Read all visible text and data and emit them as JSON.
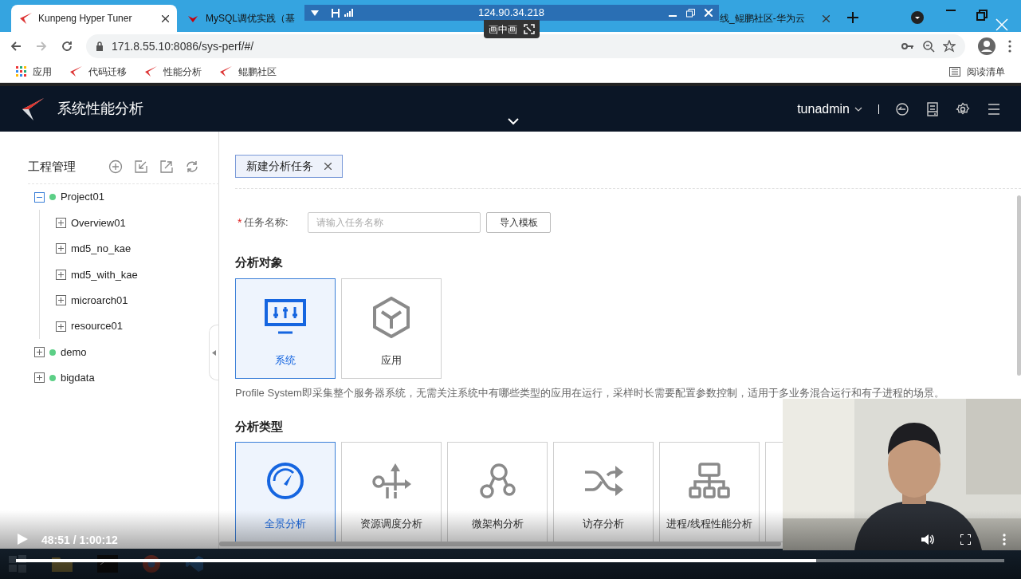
{
  "browser": {
    "tabs": [
      {
        "title": "Kunpeng Hyper Tuner",
        "selected": true
      },
      {
        "title": "MySQL调优实践（基",
        "selected": false
      },
      {
        "title": "线_鲲鹏社区-华为云",
        "selected": false
      }
    ],
    "address": "171.8.55.10:8086/sys-perf/#/",
    "bookmarks": [
      "应用",
      "代码迁移",
      "性能分析",
      "鲲鹏社区"
    ],
    "reading_list": "阅读清单"
  },
  "remote_bar": {
    "host": "124.90.34.218",
    "pip_button": "画中画"
  },
  "app": {
    "title": "系统性能分析",
    "user": "tunadmin"
  },
  "sidebar": {
    "title": "工程管理",
    "tree": [
      {
        "label": "Project01",
        "expanded": true,
        "children": [
          {
            "label": "Overview01",
            "expanded": false
          },
          {
            "label": "md5_no_kae",
            "expanded": false
          },
          {
            "label": "md5_with_kae",
            "expanded": false
          },
          {
            "label": "microarch01",
            "expanded": false
          },
          {
            "label": "resource01",
            "expanded": false
          }
        ]
      },
      {
        "label": "demo",
        "expanded": false
      },
      {
        "label": "bigdata",
        "expanded": false
      }
    ]
  },
  "open_tabs": [
    {
      "label": "新建分析任务",
      "selected": true
    }
  ],
  "form": {
    "task_name": {
      "label": "任务名称:",
      "required": true,
      "required_mark": "*",
      "placeholder": "请输入任务名称"
    },
    "import_button": "导入模板"
  },
  "target": {
    "heading": "分析对象",
    "options": [
      {
        "label": "系统",
        "kind": "monitor",
        "selected": true
      },
      {
        "label": "应用",
        "kind": "cube",
        "selected": false
      }
    ],
    "description": "Profile System即采集整个服务器系统，无需关注系统中有哪些类型的应用在运行，采样时长需要配置参数控制，适用于多业务混合运行和有子进程的场景。"
  },
  "analysis_type": {
    "heading": "分析类型",
    "options": [
      {
        "label": "全景分析",
        "kind": "gauge",
        "selected": true
      },
      {
        "label": "资源调度分析",
        "kind": "schedule",
        "selected": false
      },
      {
        "label": "微架构分析",
        "kind": "nodes",
        "selected": false
      },
      {
        "label": "访存分析",
        "kind": "shuffle",
        "selected": false
      },
      {
        "label": "进程/线程性能分析",
        "kind": "hierarchy",
        "selected": false
      }
    ]
  },
  "video": {
    "time": "48:51 / 1:00:12",
    "level": 0.81
  }
}
